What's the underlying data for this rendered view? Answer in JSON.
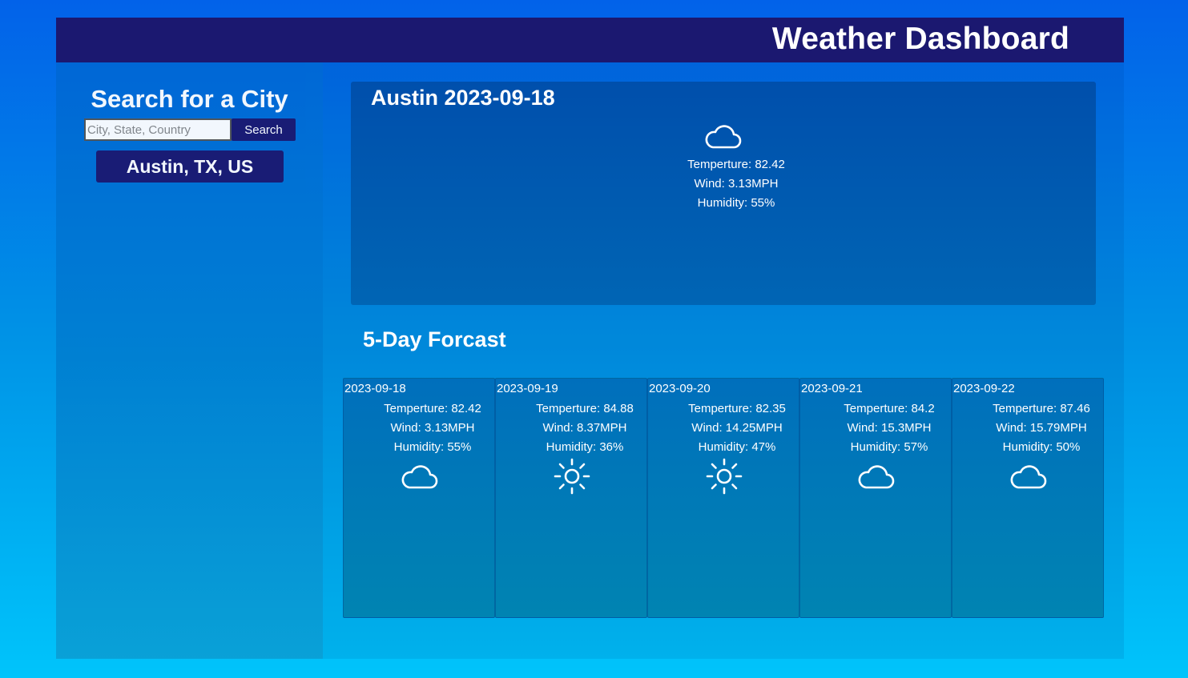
{
  "header": {
    "title": "Weather Dashboard"
  },
  "sidebar": {
    "title": "Search for a City",
    "search": {
      "placeholder": "City, State, Country",
      "value": ""
    },
    "search_button": "Search",
    "history": [
      "Austin, TX, US"
    ]
  },
  "current": {
    "title": "Austin 2023-09-18",
    "icon": "cloud-icon",
    "temperature": "Temperture: 82.42",
    "wind": "Wind: 3.13MPH",
    "humidity": "Humidity: 55%"
  },
  "forecast": {
    "title": "5-Day Forcast",
    "days": [
      {
        "date": "2023-09-18",
        "temperature": "Temperture: 82.42",
        "wind": "Wind: 3.13MPH",
        "humidity": "Humidity: 55%",
        "icon": "cloud-icon"
      },
      {
        "date": "2023-09-19",
        "temperature": "Temperture: 84.88",
        "wind": "Wind: 8.37MPH",
        "humidity": "Humidity: 36%",
        "icon": "sun-icon"
      },
      {
        "date": "2023-09-20",
        "temperature": "Temperture: 82.35",
        "wind": "Wind: 14.25MPH",
        "humidity": "Humidity: 47%",
        "icon": "sun-icon"
      },
      {
        "date": "2023-09-21",
        "temperature": "Temperture: 84.2",
        "wind": "Wind: 15.3MPH",
        "humidity": "Humidity: 57%",
        "icon": "cloud-icon"
      },
      {
        "date": "2023-09-22",
        "temperature": "Temperture: 87.46",
        "wind": "Wind: 15.79MPH",
        "humidity": "Humidity: 50%",
        "icon": "cloud-icon"
      }
    ]
  },
  "colors": {
    "header_bg": "#1b1870",
    "button_bg": "#1b1870",
    "page_gradient_top": "#0262e9",
    "page_gradient_bottom": "#00c4fb"
  }
}
